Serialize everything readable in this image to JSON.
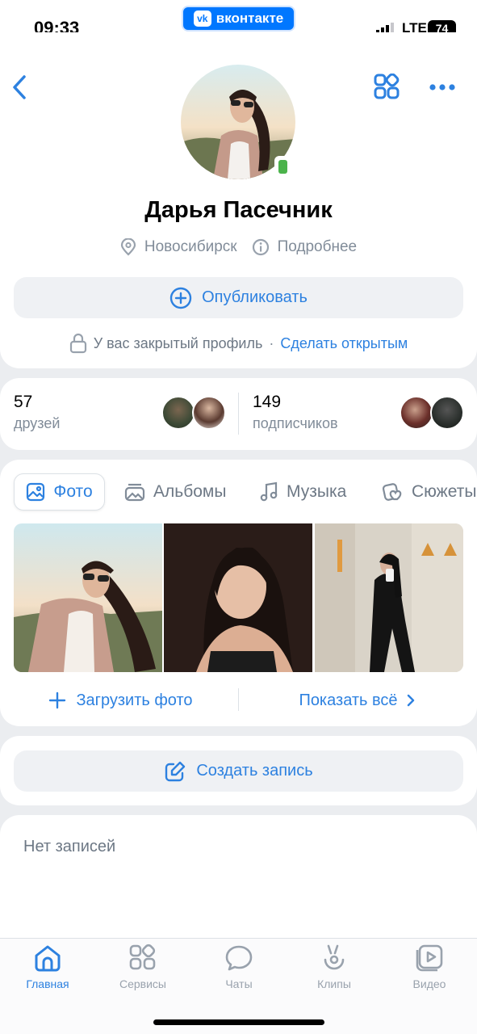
{
  "status_bar": {
    "time": "09:33",
    "app_badge": "вконтакте",
    "network": "LTE",
    "battery": "74"
  },
  "header": {
    "name": "Дарья Пасечник",
    "city": "Новосибирск",
    "details": "Подробнее"
  },
  "publish_button": "Опубликовать",
  "privacy": {
    "text": "У вас закрытый профиль",
    "separator": "·",
    "link": "Сделать открытым"
  },
  "stats": {
    "friends": {
      "count": "57",
      "label": "друзей"
    },
    "followers": {
      "count": "149",
      "label": "подписчиков"
    }
  },
  "tabs": [
    {
      "label": "Фото",
      "icon": "image-icon",
      "active": true
    },
    {
      "label": "Альбомы",
      "icon": "albums-icon"
    },
    {
      "label": "Музыка",
      "icon": "music-icon"
    },
    {
      "label": "Сюжеты",
      "icon": "heart-icon"
    }
  ],
  "photos_actions": {
    "upload": "Загрузить фото",
    "show_all": "Показать всё"
  },
  "create_post": "Создать запись",
  "empty_wall": "Нет записей",
  "bottom_nav": [
    {
      "label": "Главная",
      "icon": "home-icon",
      "active": true
    },
    {
      "label": "Сервисы",
      "icon": "services-icon"
    },
    {
      "label": "Чаты",
      "icon": "chat-icon"
    },
    {
      "label": "Клипы",
      "icon": "clips-icon"
    },
    {
      "label": "Видео",
      "icon": "video-icon"
    }
  ],
  "colors": {
    "accent": "#2d81e0",
    "secondary_text": "#818c99",
    "background": "#ebedf0",
    "online": "#4bb34b"
  }
}
